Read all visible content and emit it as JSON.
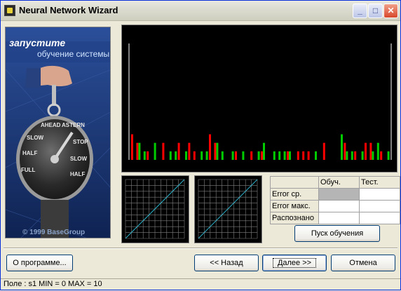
{
  "window": {
    "title": "Neural Network Wizard"
  },
  "side_panel": {
    "line1": "запустите",
    "line2": "обучение системы",
    "copyright": "© 1999 BaseGroup",
    "dial_words": [
      "SLOW",
      "HALF",
      "FULL",
      "AHEAD",
      "ASTERN",
      "STOP",
      "SLOW",
      "HALF"
    ]
  },
  "stats_table": {
    "columns": [
      "Обуч.",
      "Тест."
    ],
    "rows": [
      {
        "label": "Error ср."
      },
      {
        "label": "Error макс."
      },
      {
        "label": "Распознано"
      }
    ]
  },
  "buttons": {
    "start_training": "Пуск обучения",
    "about": "О программе...",
    "back": "<< Назад",
    "next": "Далее >>",
    "cancel": "Отмена"
  },
  "status_bar": "Поле : s1  MIN = 0 MAX = 10",
  "chart_data": {
    "type": "bar",
    "series": [
      {
        "color": "#ff0000",
        "values": [
          3,
          2,
          0,
          1,
          0,
          0,
          2,
          0,
          0,
          2,
          0,
          2,
          1,
          0,
          0,
          3,
          2,
          0,
          0,
          0,
          1,
          0,
          0,
          1,
          0,
          1,
          0,
          0,
          0,
          0,
          1,
          0,
          1,
          1,
          1,
          0,
          0,
          2,
          0,
          0,
          0,
          2,
          0,
          1,
          0,
          2,
          2,
          0,
          1,
          0
        ]
      },
      {
        "color": "#00cc00",
        "values": [
          0,
          2,
          1,
          0,
          2,
          0,
          0,
          1,
          1,
          0,
          1,
          0,
          0,
          1,
          1,
          0,
          2,
          1,
          0,
          1,
          0,
          1,
          0,
          0,
          1,
          2,
          0,
          1,
          1,
          1,
          1,
          0,
          0,
          0,
          0,
          1,
          0,
          0,
          0,
          0,
          3,
          1,
          1,
          0,
          1,
          0,
          1,
          2,
          0,
          1
        ]
      }
    ],
    "ylim": [
      0,
      30
    ],
    "axes_color": "#ffffff"
  },
  "mini_plots": [
    {
      "grid_color": "#808080",
      "line_color": "#2fb0c8"
    },
    {
      "grid_color": "#808080",
      "line_color": "#2fb0c8"
    }
  ]
}
